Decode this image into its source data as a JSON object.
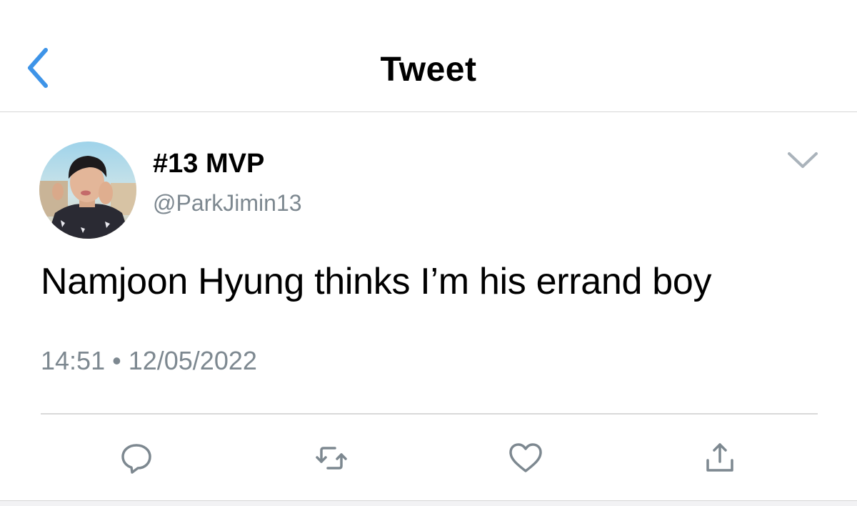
{
  "header": {
    "title": "Tweet",
    "back_icon": "chevron-left-icon",
    "accent_color": "#3e94e8"
  },
  "tweet": {
    "display_name": "#13 MVP",
    "handle": "@ParkJimin13",
    "text": "Namjoon Hyung thinks I’m his errand boy",
    "time": "14:51",
    "separator": "•",
    "date": "12/05/2022"
  },
  "actions": [
    {
      "name": "reply",
      "icon": "reply-icon"
    },
    {
      "name": "retweet",
      "icon": "retweet-icon"
    },
    {
      "name": "like",
      "icon": "heart-icon"
    },
    {
      "name": "share",
      "icon": "share-icon"
    }
  ],
  "colors": {
    "secondary_text": "#7d8890",
    "icon_gray": "#7d8890",
    "divider": "#d9d9d9"
  }
}
